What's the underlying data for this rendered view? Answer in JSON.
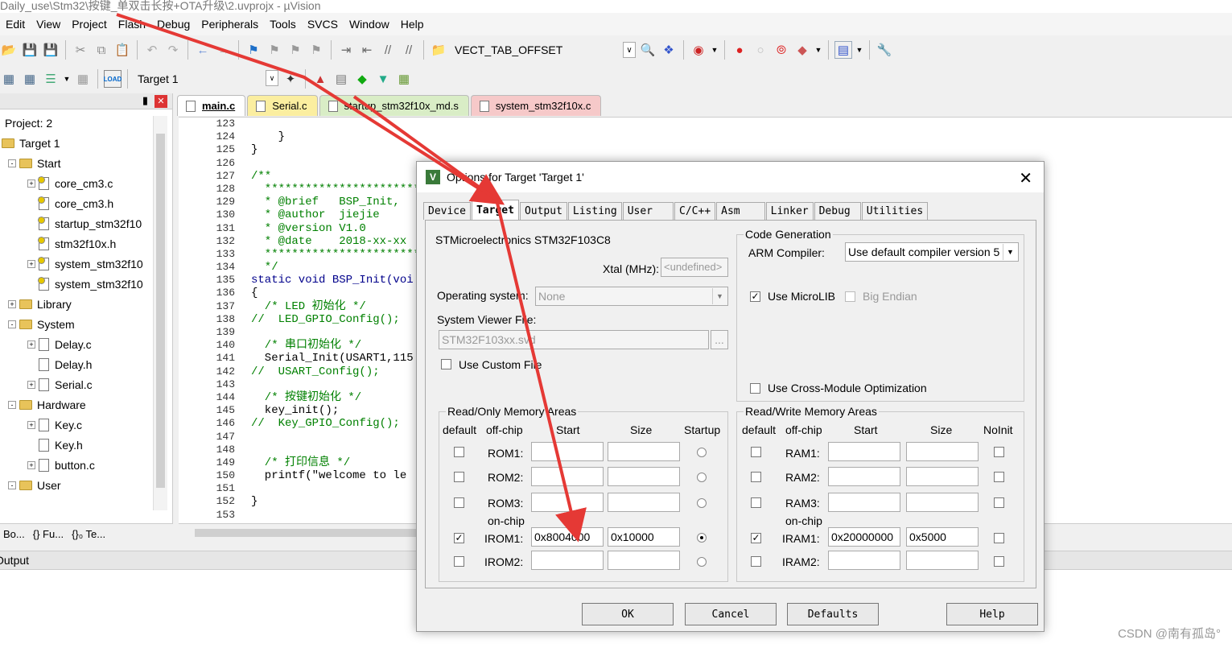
{
  "window": {
    "title": "Daily_use\\Stm32\\按键_单双击长按+OTA升级\\2.uvprojx - µVision"
  },
  "menu": [
    "Edit",
    "View",
    "Project",
    "Flash",
    "Debug",
    "Peripherals",
    "Tools",
    "SVCS",
    "Window",
    "Help"
  ],
  "toolbar": {
    "define_combo": "VECT_TAB_OFFSET",
    "target_combo": "Target 1",
    "load_label": "LOAD"
  },
  "project": {
    "header": "Project: 2",
    "target": "Target 1",
    "groups": {
      "start": "Start",
      "library": "Library",
      "system": "System",
      "hardware": "Hardware",
      "user": "User"
    },
    "files": {
      "f1": "core_cm3.c",
      "f2": "core_cm3.h",
      "f3": "startup_stm32f10",
      "f4": "stm32f10x.h",
      "f5": "system_stm32f10",
      "f6": "system_stm32f10",
      "f7": "Delay.c",
      "f8": "Delay.h",
      "f9": "Serial.c",
      "f10": "Key.c",
      "f11": "Key.h",
      "f12": "button.c"
    },
    "bottom_tabs": [
      "Bo...",
      "{} Fu...",
      "{}₀ Te..."
    ]
  },
  "editor_tabs": [
    "main.c",
    "Serial.c",
    "startup_stm32f10x_md.s",
    "system_stm32f10x.c"
  ],
  "code": {
    "lines": [
      "123",
      "124",
      "125",
      "126",
      "127",
      "128",
      "129",
      "130",
      "131",
      "132",
      "133",
      "134",
      "135",
      "136",
      "137",
      "138",
      "139",
      "140",
      "141",
      "142",
      "143",
      "144",
      "145",
      "146",
      "147",
      "148",
      "149",
      "150",
      "151",
      "152",
      "153"
    ],
    "l123": "",
    "l124": "    }",
    "l125": "}",
    "l126": "",
    "l127": "/**",
    "l128": "  ***********************",
    "l129": "  * @brief   BSP_Init, ",
    "l130": "  * @author  jiejie",
    "l131": "  * @version V1.0",
    "l132": "  * @date    2018-xx-xx",
    "l133": "  ***********************",
    "l134": "  */",
    "l135": "static void BSP_Init(voi",
    "l136": "{",
    "l137": "  /* LED 初始化 */",
    "l138": "//  LED_GPIO_Config();",
    "l139": "",
    "l140": "  /* 串口初始化 */",
    "l141": "  Serial_Init(USART1,115",
    "l142": "//  USART_Config();",
    "l143": "",
    "l144": "  /* 按键初始化 */",
    "l145": "  key_init();",
    "l146": "//  Key_GPIO_Config();",
    "l147": "",
    "l148": "",
    "l149": "  /* 打印信息 */",
    "l150": "  printf(\"welcome to le",
    "l151": "",
    "l152": "}",
    "l153": ""
  },
  "output": {
    "label": "Output"
  },
  "dialog": {
    "title": "Options for Target 'Target 1'",
    "tabs": [
      "Device",
      "Target",
      "Output",
      "Listing",
      "User",
      "C/C++",
      "Asm",
      "Linker",
      "Debug",
      "Utilities"
    ],
    "device": "STMicroelectronics STM32F103C8",
    "xtal_label": "Xtal (MHz):",
    "xtal_value": "<undefined>",
    "os_label": "Operating system:",
    "os_value": "None",
    "svd_label": "System Viewer File:",
    "svd_value": "STM32F103xx.svd",
    "svd_btn": "...",
    "custom_file": "Use Custom File",
    "codegen": {
      "title": "Code Generation",
      "arm_label": "ARM Compiler:",
      "arm_value": "Use default compiler version 5",
      "microlib": "Use MicroLIB",
      "big_endian": "Big Endian",
      "cross_module": "Use Cross-Module Optimization"
    },
    "ro": {
      "title": "Read/Only Memory Areas",
      "h_default": "default",
      "h_offchip": "off-chip",
      "h_start": "Start",
      "h_size": "Size",
      "h_startup": "Startup",
      "onchip": "on-chip",
      "rows": [
        {
          "name": "ROM1:",
          "start": "",
          "size": ""
        },
        {
          "name": "ROM2:",
          "start": "",
          "size": ""
        },
        {
          "name": "ROM3:",
          "start": "",
          "size": ""
        },
        {
          "name": "IROM1:",
          "start": "0x8004000",
          "size": "0x10000"
        },
        {
          "name": "IROM2:",
          "start": "",
          "size": ""
        }
      ]
    },
    "rw": {
      "title": "Read/Write Memory Areas",
      "h_default": "default",
      "h_offchip": "off-chip",
      "h_start": "Start",
      "h_size": "Size",
      "h_noinit": "NoInit",
      "onchip": "on-chip",
      "rows": [
        {
          "name": "RAM1:",
          "start": "",
          "size": ""
        },
        {
          "name": "RAM2:",
          "start": "",
          "size": ""
        },
        {
          "name": "RAM3:",
          "start": "",
          "size": ""
        },
        {
          "name": "IRAM1:",
          "start": "0x20000000",
          "size": "0x5000"
        },
        {
          "name": "IRAM2:",
          "start": "",
          "size": ""
        }
      ]
    },
    "buttons": {
      "ok": "OK",
      "cancel": "Cancel",
      "defaults": "Defaults",
      "help": "Help"
    }
  },
  "watermark": "CSDN @南有孤岛°",
  "annotation": {
    "color": "#e53935"
  }
}
